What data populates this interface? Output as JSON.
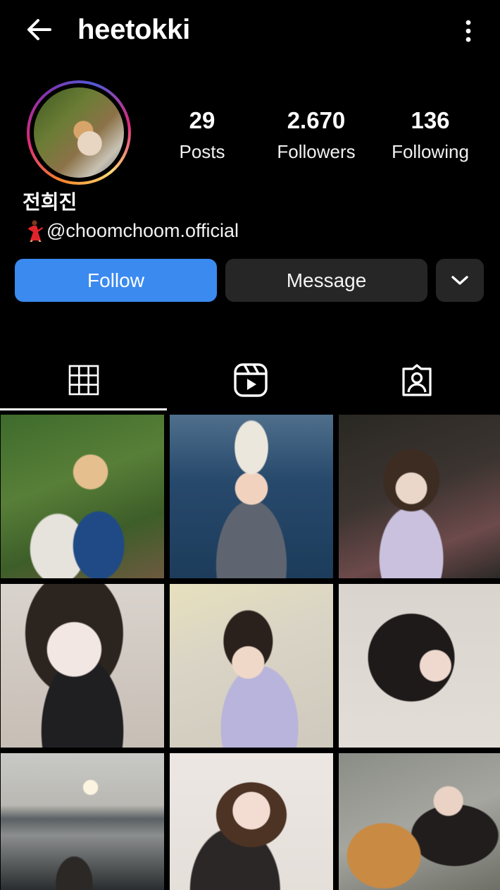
{
  "header": {
    "username": "heetokki",
    "back_icon": "arrow-left-icon",
    "more_icon": "more-vertical-icon"
  },
  "profile": {
    "full_name": "전희진",
    "bio": "@choomchoom.official",
    "bio_emoji_icon": "dancer-emoji-icon",
    "stats": [
      {
        "value": "29",
        "label": "Posts"
      },
      {
        "value": "2.670",
        "label": "Followers"
      },
      {
        "value": "136",
        "label": "Following"
      }
    ]
  },
  "actions": {
    "follow_label": "Follow",
    "message_label": "Message",
    "suggest_icon": "chevron-down-icon"
  },
  "tabs": [
    {
      "name": "posts-grid",
      "icon": "grid-icon",
      "active": true
    },
    {
      "name": "reels",
      "icon": "reels-icon",
      "active": false
    },
    {
      "name": "tagged",
      "icon": "tagged-person-icon",
      "active": false
    }
  ],
  "colors": {
    "background": "#000000",
    "follow_button": "#3a8af0",
    "secondary_button": "#262626",
    "text": "#ffffff"
  }
}
